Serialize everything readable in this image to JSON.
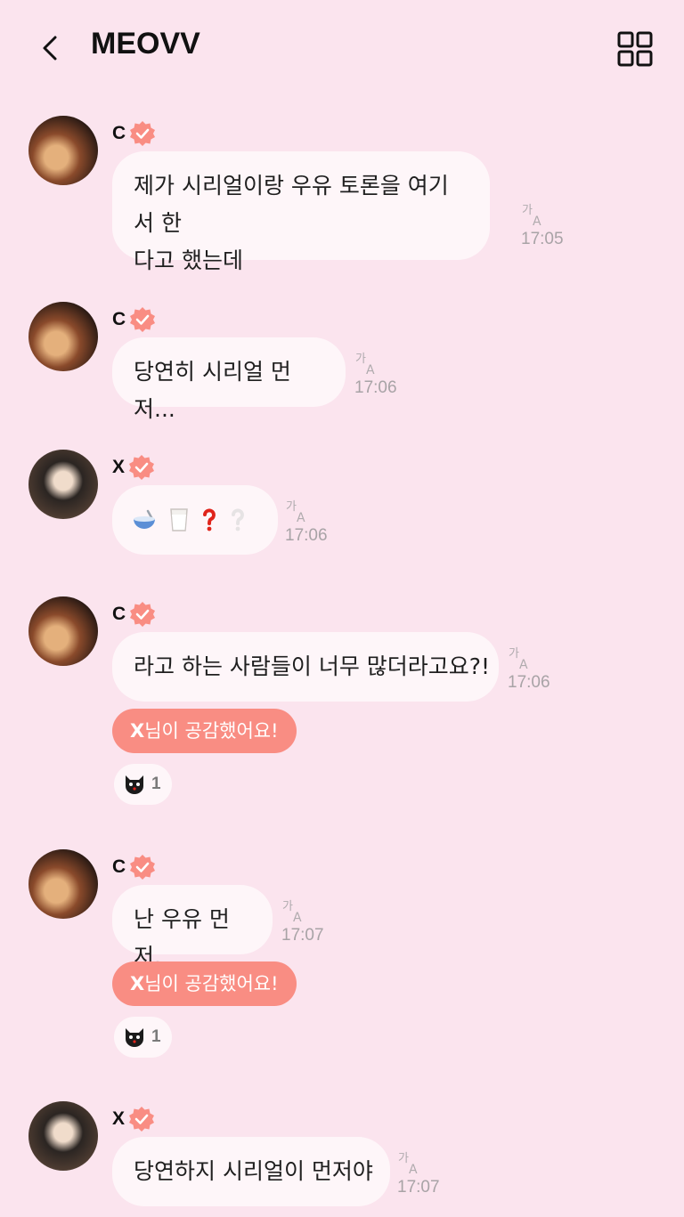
{
  "header": {
    "title": "MEOVV"
  },
  "messages": [
    {
      "author": "C",
      "lines": [
        "제가 시리얼이랑 우유 토론을 여기서 한",
        "다고 했는데"
      ],
      "time": "17:05"
    },
    {
      "author": "C",
      "lines": [
        "당연히 시리얼 먼저..."
      ],
      "time": "17:06"
    },
    {
      "author": "X",
      "emoji": [
        "bowl-spoon",
        "milk-glass",
        "red-question",
        "white-question"
      ],
      "time": "17:06"
    },
    {
      "author": "C",
      "lines": [
        "라고 하는 사람들이 너무 많더라고요?!"
      ],
      "time": "17:06",
      "reaction": {
        "name": "X",
        "text": "님이 공감했어요!"
      },
      "reaction_count": "1"
    },
    {
      "author": "C",
      "lines": [
        "난 우유 먼저."
      ],
      "time": "17:07",
      "reaction": {
        "name": "X",
        "text": "님이 공감했어요!"
      },
      "reaction_count": "1"
    },
    {
      "author": "X",
      "lines": [
        "당연하지 시리얼이 먼저야"
      ],
      "time": "17:07"
    }
  ],
  "colors": {
    "background": "#FBE4EE",
    "bubble": "#FEF6F9",
    "accent": "#F98D83",
    "time": "#a8a3a6"
  },
  "icons": {
    "back": "chevron-left-icon",
    "menu": "grid-icon",
    "verified": "verified-badge-icon",
    "translate": "translate-icon",
    "reaction": "black-cat-icon"
  }
}
